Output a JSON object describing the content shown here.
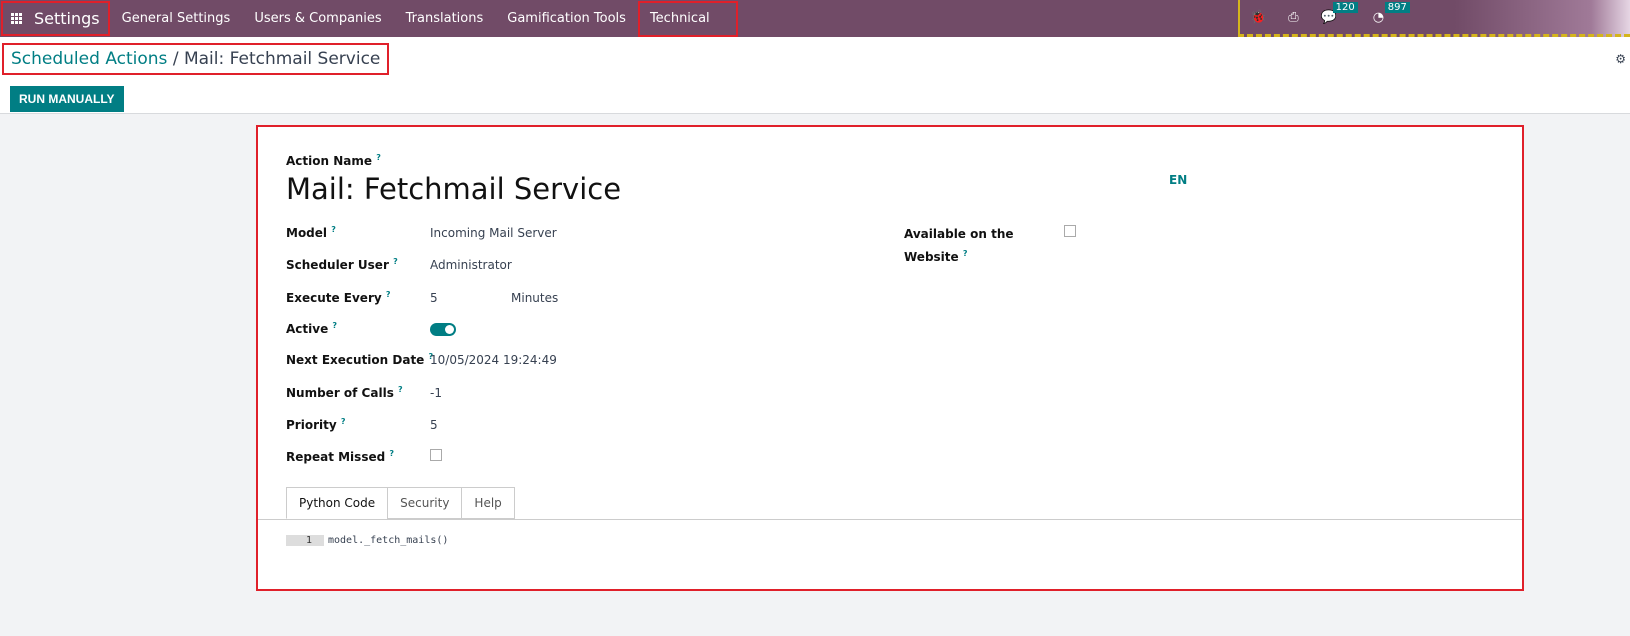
{
  "nav": {
    "app": "Settings",
    "menus": [
      "General Settings",
      "Users & Companies",
      "Translations",
      "Gamification Tools",
      "Technical"
    ],
    "messages_count": "120",
    "activities_count": "897"
  },
  "breadcrumb": {
    "parent": "Scheduled Actions",
    "sep": "/",
    "current": "Mail: Fetchmail Service"
  },
  "toolbar": {
    "run": "RUN MANUALLY"
  },
  "form": {
    "action_name_label": "Action Name",
    "action_name": "Mail: Fetchmail Service",
    "lang": "EN",
    "q": "?",
    "fields": [
      {
        "label": "Model",
        "value": "Incoming Mail Server"
      },
      {
        "label": "Scheduler User",
        "value": "Administrator"
      },
      {
        "label": "Execute Every",
        "value": "5",
        "unit": "Minutes"
      },
      {
        "label": "Active",
        "value": true
      },
      {
        "label": "Next Execution Date",
        "value": "10/05/2024 19:24:49"
      },
      {
        "label": "Number of Calls",
        "value": "-1"
      },
      {
        "label": "Priority",
        "value": "5"
      },
      {
        "label": "Repeat Missed",
        "value": false
      }
    ],
    "website_label1": "Available on the",
    "website_label2": "Website",
    "website_value": false,
    "tabs": [
      "Python Code",
      "Security",
      "Help"
    ],
    "code": {
      "line": "1",
      "text": "model._fetch_mails()"
    }
  },
  "colors": {
    "nav": "#714b67",
    "accent": "#017e84",
    "highlight": "#e0202a"
  }
}
